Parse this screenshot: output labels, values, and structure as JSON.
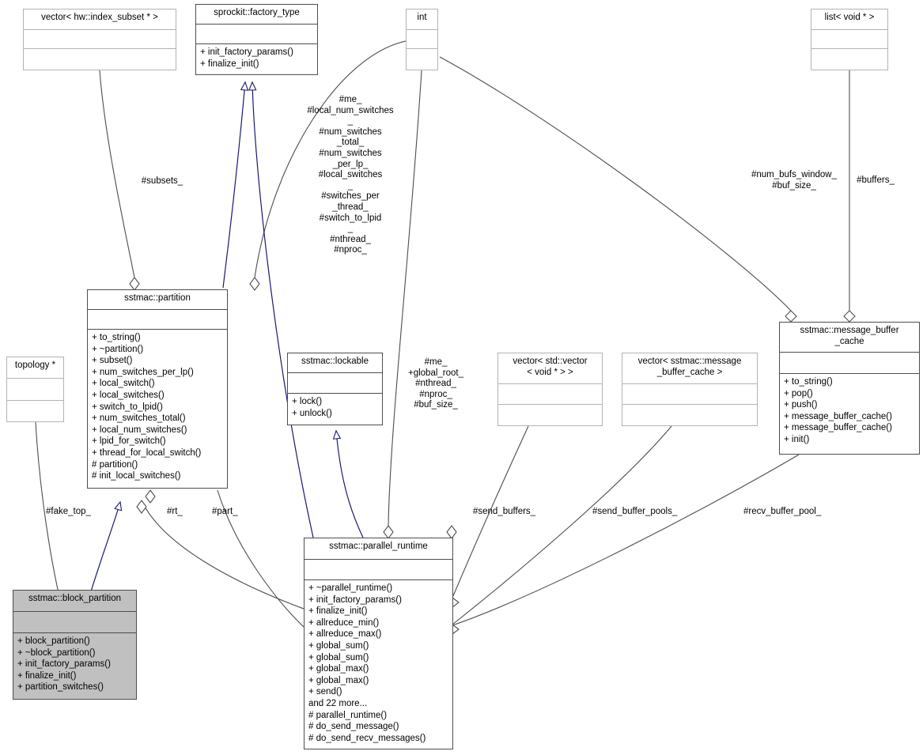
{
  "diagram": {
    "kind": "uml-collaboration-diagram",
    "title": "sstmac::block_partition collaboration diagram",
    "colors": {
      "background": "#ffffff",
      "node_border_solid": "#4d4d4d",
      "node_border_light": "#b3b3b3",
      "node_fill": "#ffffff",
      "current_node_fill": "#c0c0c0",
      "inheritance_edge": "#191970",
      "association_edge": "#4d4d4d",
      "text": "#000000"
    }
  },
  "nodes": {
    "vector_index_subset": {
      "title": "vector< hw::index_subset * >",
      "attributes": [],
      "operations": [],
      "style": "light"
    },
    "factory_type": {
      "title": "sprockit::factory_type",
      "attributes": [],
      "operations": [
        "+ init_factory_params()",
        "+ finalize_init()"
      ],
      "style": "solid"
    },
    "int_type": {
      "title": "int",
      "attributes": [],
      "operations": [],
      "style": "light"
    },
    "list_void": {
      "title": "list< void * >",
      "attributes": [],
      "operations": [],
      "style": "light"
    },
    "partition": {
      "title": "sstmac::partition",
      "attributes": [],
      "operations": [
        "+ to_string()",
        "+ ~partition()",
        "+ subset()",
        "+ num_switches_per_lp()",
        "+ local_switch()",
        "+ local_switches()",
        "+ switch_to_lpid()",
        "+ num_switches_total()",
        "+ local_num_switches()",
        "+ lpid_for_switch()",
        "+ thread_for_local_switch()",
        "# partition()",
        "# init_local_switches()"
      ],
      "style": "solid"
    },
    "topology": {
      "title": "topology *",
      "attributes": [],
      "operations": [],
      "style": "light"
    },
    "lockable": {
      "title": "sstmac::lockable",
      "attributes": [],
      "operations": [
        "+ lock()",
        "+ unlock()"
      ],
      "style": "solid"
    },
    "vector_std_vector_void": {
      "title": "vector< std::vector\n< void * > >",
      "attributes": [],
      "operations": [],
      "style": "light"
    },
    "vector_message_buffer_cache": {
      "title": "vector< sstmac::message\n_buffer_cache >",
      "attributes": [],
      "operations": [],
      "style": "light"
    },
    "message_buffer_cache": {
      "title": "sstmac::message_buffer\n_cache",
      "attributes": [],
      "operations": [
        "+ to_string()",
        "+ pop()",
        "+ push()",
        "+ message_buffer_cache()",
        "+ message_buffer_cache()",
        "+ init()"
      ],
      "style": "solid"
    },
    "parallel_runtime": {
      "title": "sstmac::parallel_runtime",
      "attributes": [],
      "operations": [
        "+ ~parallel_runtime()",
        "+ init_factory_params()",
        "+ finalize_init()",
        "+ allreduce_min()",
        "+ allreduce_max()",
        "+ global_sum()",
        "+ global_sum()",
        "+ global_max()",
        "+ global_max()",
        "+ send()",
        "and 22 more...",
        "# parallel_runtime()",
        "# do_send_message()",
        "# do_send_recv_messages()"
      ],
      "style": "solid"
    },
    "block_partition": {
      "title": "sstmac::block_partition",
      "attributes": [],
      "operations": [
        "+ block_partition()",
        "+ ~block_partition()",
        "+ init_factory_params()",
        "+ finalize_init()",
        "+ partition_switches()"
      ],
      "style": "current"
    }
  },
  "edge_labels": {
    "subsets": "#subsets_",
    "partition_members": "#me_\n#local_num_switches\n_\n#num_switches\n_total_\n#num_switches\n_per_lp_\n#local_switches\n_\n#switches_per\n_thread_\n#switch_to_lpid\n_\n#nthread_\n#nproc_",
    "runtime_members": "#me_\n+global_root_\n#nthread_\n#nproc_\n#buf_size_",
    "num_bufs_window": "#num_bufs_window_\n#buf_size_",
    "buffers": "#buffers_",
    "fake_top": "#fake_top_",
    "rt": "#rt_",
    "part": "#part_",
    "send_buffers": "#send_buffers_",
    "send_buffer_pools": "#send_buffer_pools_",
    "recv_buffer_pool": "#recv_buffer_pool_"
  }
}
